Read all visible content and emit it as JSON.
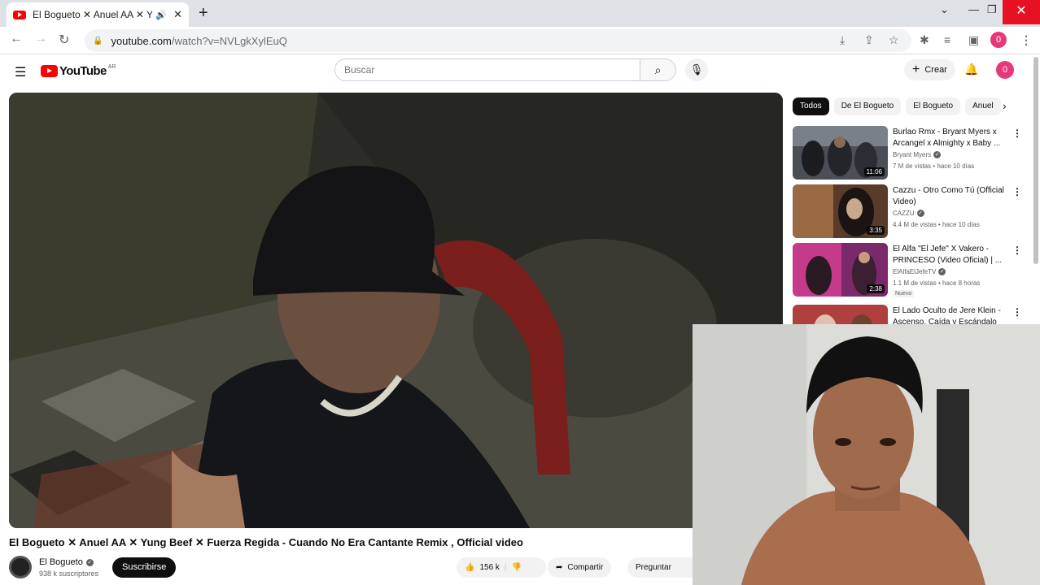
{
  "browser": {
    "tab_title": "El Bogueto ✕ Anuel AA ✕ Y",
    "url_host": "youtube.com",
    "url_path": "/watch?v=NVLgkXylEuQ",
    "profile_initial": "0"
  },
  "yt": {
    "logo_text": "YouTube",
    "region": "AR",
    "search_placeholder": "Buscar",
    "create_label": "Crear",
    "avatar_initial": "0"
  },
  "video": {
    "title": "El Bogueto ✕ Anuel AA ✕ Yung Beef ✕ Fuerza Regida - Cuando No Era Cantante Remix , Official video",
    "channel": "El Bogueto",
    "subscribers": "938 k suscriptores",
    "subscribe_label": "Suscribirse",
    "likes": "156 k",
    "share_label": "Compartir",
    "ask_label": "Preguntar"
  },
  "chips": [
    "Todos",
    "De El Bogueto",
    "El Bogueto",
    "Anuel"
  ],
  "recommendations": [
    {
      "title": "Burlao Rmx - Bryant Myers x Arcangel x Almighty x Baby ...",
      "channel": "Bryant Myers",
      "meta": "7 M de vistas • hace 10 días",
      "duration": "11:06",
      "badge": ""
    },
    {
      "title": "Cazzu - Otro Como Tú (Official Video)",
      "channel": "CAZZU",
      "meta": "4.4 M de vistas • hace 10 días",
      "duration": "3:35",
      "badge": ""
    },
    {
      "title": "El Alfa \"El Jefe\" X Vakero - PRINCESO (Video Oficial) | ...",
      "channel": "ElAlfaElJefeTV",
      "meta": "1.1 M de vistas • hace 8 horas",
      "duration": "2:38",
      "badge": "Nuevo"
    },
    {
      "title": "El Lado Oculto de Jere Klein - Ascenso, Caída y Escándalo",
      "channel": "",
      "meta": "",
      "duration": "",
      "badge": ""
    }
  ],
  "colors": {
    "brand_red": "#ff0000",
    "profile_pink": "#e6397b"
  }
}
